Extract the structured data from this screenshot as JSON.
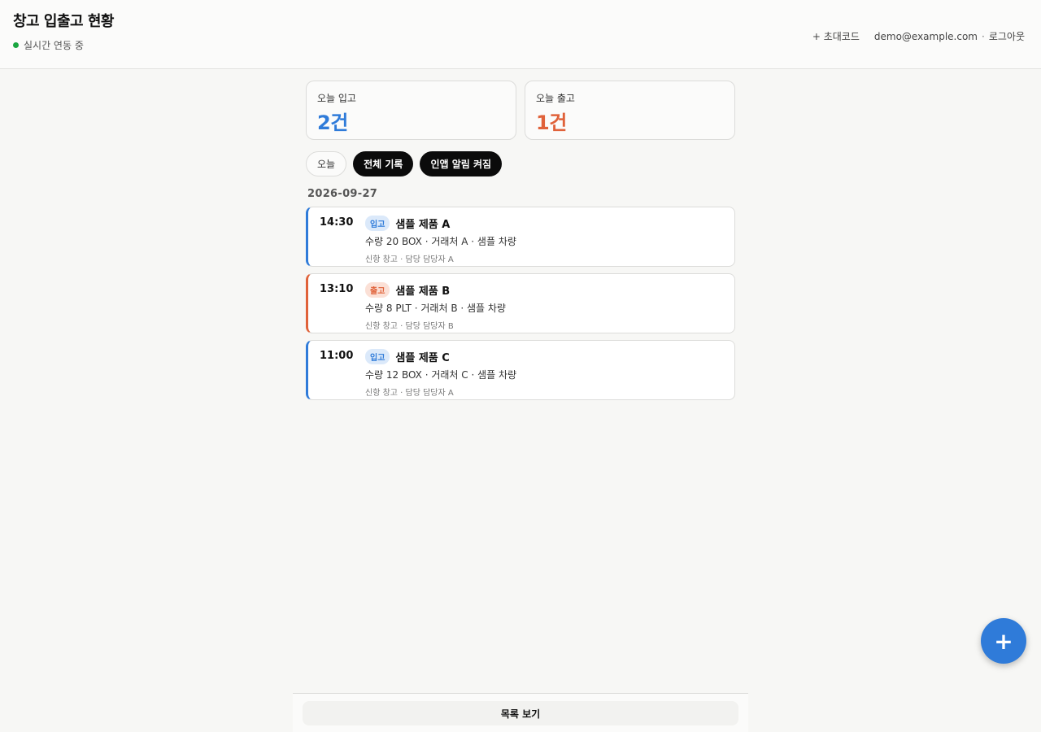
{
  "header": {
    "title": "창고 입출고 현황",
    "status": "실시간 연동 중",
    "invite_label": "+ 초대코드",
    "user_email": "demo@example.com",
    "separator": "·",
    "logout_label": "로그아웃"
  },
  "stats": {
    "in_label": "오늘 입고",
    "in_value": "2건",
    "out_label": "오늘 출고",
    "out_value": "1건"
  },
  "filters": [
    {
      "label": "오늘"
    },
    {
      "label": "전체 기록"
    },
    {
      "label": "인앱 알림 켜짐"
    }
  ],
  "date_heading": "2026-09-27",
  "records": [
    {
      "time": "14:30",
      "type": "입고",
      "name": "샘플 제품 A",
      "detail": "수량 20 BOX · 거래처 A · 샘플 차량",
      "meta": "신항 창고 · 담당 담당자 A"
    },
    {
      "time": "13:10",
      "type": "출고",
      "name": "샘플 제품 B",
      "detail": "수량 8 PLT · 거래처 B · 샘플 차량",
      "meta": "신항 창고 · 담당 담당자 B"
    },
    {
      "time": "11:00",
      "type": "입고",
      "name": "샘플 제품 C",
      "detail": "수량 12 BOX · 거래처 C · 샘플 차량",
      "meta": "신항 창고 · 담당 담당자 A"
    }
  ],
  "fab_label": "+",
  "bottom": {
    "list_view_label": "목록 보기"
  },
  "colors": {
    "in": "#2f7bd9",
    "out": "#e0623a",
    "live": "#1aa640",
    "fab": "#2f7bd9"
  }
}
